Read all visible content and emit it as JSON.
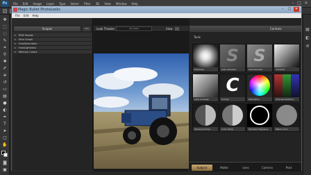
{
  "photoshop": {
    "logo": "Ps",
    "menus": [
      "File",
      "Edit",
      "Image",
      "Layer",
      "Type",
      "Select",
      "Filter",
      "3D",
      "View",
      "Window",
      "Help"
    ],
    "window_controls": [
      "–",
      "□",
      "✕"
    ]
  },
  "magic_bullet": {
    "title": "Magic Bullet PhotoLooks",
    "menus": [
      "File",
      "Edit",
      "Help"
    ],
    "window_controls": [
      "–",
      "□",
      "✕"
    ]
  },
  "scopes": {
    "header": "Scopes",
    "size_label": "Size",
    "items": [
      "RGB Parade",
      "Slice Graph",
      "Hue/Saturation",
      "Hue/Lightness",
      "Memory Colors"
    ]
  },
  "look_theater": {
    "label": "Look Theater",
    "filter": "All Looks",
    "view_label": "View"
  },
  "tools_panel": {
    "controls_label": "Controls",
    "section_label": "Tools",
    "tools": [
      {
        "name": "Exposure"
      },
      {
        "name": "Auto Shoulder"
      },
      {
        "name": "Soft Shoulder"
      },
      {
        "name": "Contrast"
      },
      {
        "name": "Lens Contrast"
      },
      {
        "name": "Curves"
      },
      {
        "name": "Saturation"
      },
      {
        "name": "Channel Switcher"
      },
      {
        "name": "Vibrance Pump"
      },
      {
        "name": "Color Temp"
      },
      {
        "name": "Shoulder Exposure"
      },
      {
        "name": "Match Color"
      }
    ]
  },
  "bottom_tabs": [
    "Subject",
    "Matte",
    "Lens",
    "Camera",
    "Post"
  ],
  "active_tab": "Subject",
  "colors": {
    "accent": "#c8a873",
    "titlebar": "#9bb3cd",
    "panel": "#2a2a2a"
  }
}
